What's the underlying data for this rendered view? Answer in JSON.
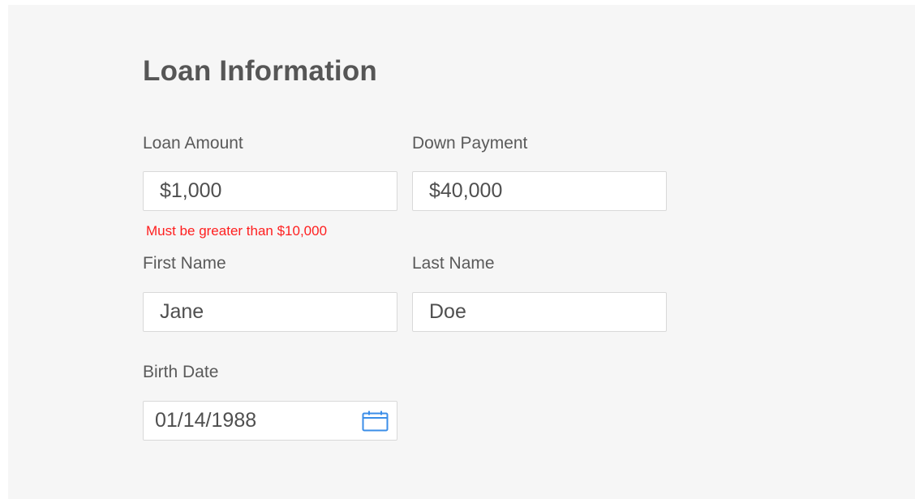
{
  "form": {
    "title": "Loan Information",
    "loan_amount": {
      "label": "Loan Amount",
      "value": "$1,000",
      "error": "Must be greater than $10,000"
    },
    "down_payment": {
      "label": "Down Payment",
      "value": "$40,000"
    },
    "first_name": {
      "label": "First Name",
      "value": "Jane"
    },
    "last_name": {
      "label": "Last Name",
      "value": "Doe"
    },
    "birth_date": {
      "label": "Birth Date",
      "value": "01/14/1988",
      "icon": "calendar-icon"
    }
  },
  "colors": {
    "background": "#f6f6f6",
    "error": "#ff1f1f",
    "icon_accent": "#3b8ee8",
    "text": "#565656"
  }
}
